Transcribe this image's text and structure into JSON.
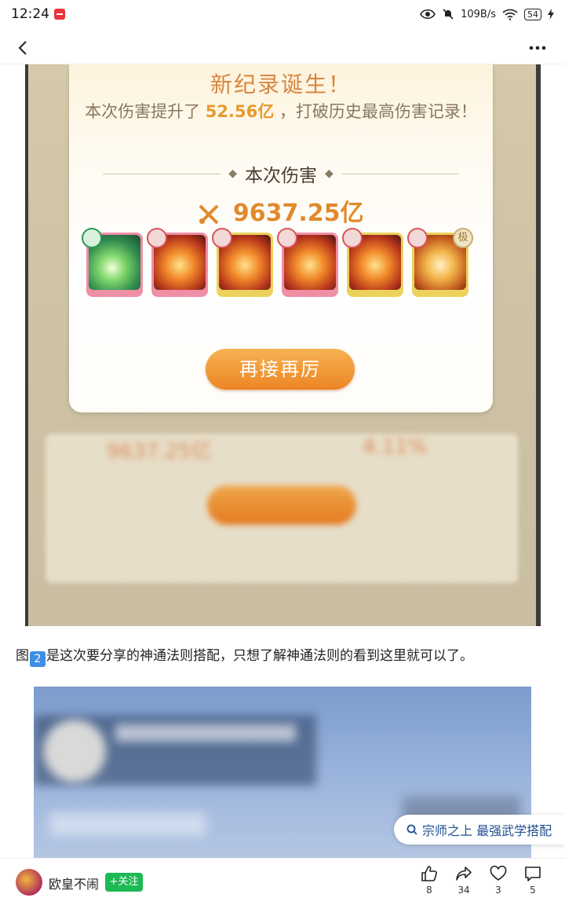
{
  "status_bar": {
    "time": "12:24",
    "net_speed": "109B/s",
    "battery": "54"
  },
  "game_screenshot": {
    "popup": {
      "title": "新纪录诞生！",
      "subtitle_prefix": "本次伤害提升了",
      "subtitle_value": "52.56亿",
      "subtitle_suffix": "，打破历史最高伤害记录！",
      "section_label": "本次伤害",
      "damage_value": "9637.25亿",
      "skills": [
        {
          "name": "jade-skill",
          "frame": "#ef8fa6",
          "tone": "green"
        },
        {
          "name": "phoenix-skill",
          "frame": "#ef8fa6",
          "tone": "red"
        },
        {
          "name": "flame-buddha-skill",
          "frame": "#ecd25c",
          "tone": "red"
        },
        {
          "name": "pagoda-skill",
          "frame": "#ef8fa6",
          "tone": "red"
        },
        {
          "name": "golden-buddha-skill",
          "frame": "#ecd25c",
          "tone": "red"
        },
        {
          "name": "lotus-skill",
          "frame": "#ecd25c",
          "tone": "tier",
          "tier_label": "极"
        }
      ],
      "button": "再接再厉"
    },
    "blurred": {
      "damage": "9637.25亿",
      "percent": "4.11%"
    }
  },
  "article": {
    "para_prefix": "图",
    "para_badge": "2",
    "para_text": "是这次要分享的神通法则搭配，只想了解神通法则的看到这里就可以了。"
  },
  "search_chip": {
    "text": "宗师之上 最强武学搭配"
  },
  "bottom_bar": {
    "author": "欧皇不闹",
    "follow": "+关注",
    "like_count": "8",
    "share_count": "34",
    "favorite_count": "3",
    "comment_count": "5"
  },
  "colors": {
    "accent_orange": "#e08a2c",
    "follow_green": "#1db954",
    "link_blue": "#1f4e90"
  }
}
